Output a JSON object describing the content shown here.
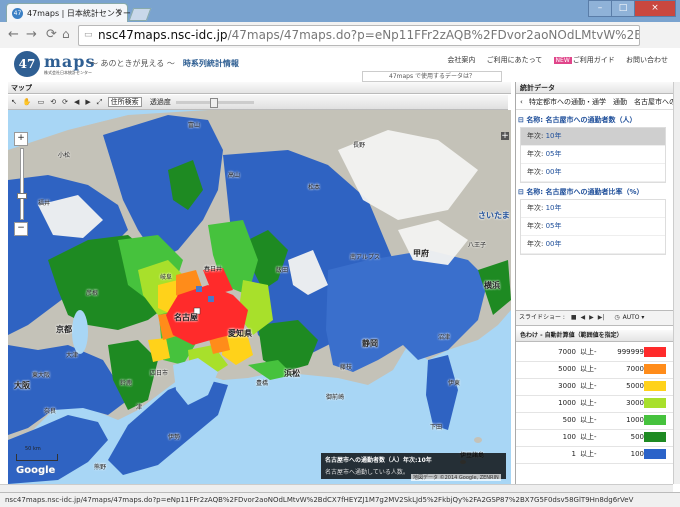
{
  "browser": {
    "tab_title": "47maps | 日本統計センター",
    "favicon_text": "47",
    "url_host": "nsc47maps.nsc-idc.jp",
    "url_path": "/47maps/47maps.do?p=eNp11FFr2zAQB%2FDvor2aoNOdLMtvW%2BdCX7fHEYZJ1M7g2M",
    "status_url": "nsc47maps.nsc-idc.jp/47maps/47maps.do?p=eNp11FFr2zAQB%2FDvor2aoNOdLMtvW%2BdCX7fHEYZJ1M7g2MV2SkLJd5%2FkbjQy%2FA2GSP87%2BX7G5F0dsv58GlT9Hn8dg6rVeV"
  },
  "site": {
    "logo_number": "47",
    "logo_name": "maps",
    "logo_company": "株式会社日本統計センター",
    "slogan_prefix": "～ あのときが見える ～",
    "slogan_title": "時系列統計情報",
    "links": [
      "会社案内",
      "ご利用にあたって",
      "ご利用ガイド",
      "お問い合わせ"
    ],
    "new_badge": "NEW",
    "notice": "47maps で使用するデータは？"
  },
  "map_panel": {
    "title": "マップ",
    "tools": [
      "↖",
      "✋",
      "▭",
      "⟲",
      "⟳",
      "◀",
      "▶",
      "⤢"
    ],
    "address_search": "住所検索",
    "opacity_label": "透過度",
    "opacity_value": 0.45,
    "legend_title": "名古屋市への通勤者数（人）年次:10年",
    "legend_desc": "名古屋市へ通勤している人数。",
    "copyright": "地図データ ©2014 Google, ZENRIN",
    "scale": "50 km",
    "google": "Google"
  },
  "map_labels": [
    {
      "t": "名古屋",
      "k": "b"
    },
    {
      "t": "愛知県",
      "k": "b"
    },
    {
      "t": "岐阜",
      "k": "b"
    },
    {
      "t": "静岡",
      "k": "b"
    },
    {
      "t": "浜松",
      "k": "b"
    },
    {
      "t": "京都",
      "k": "b"
    },
    {
      "t": "大阪",
      "k": "b"
    },
    {
      "t": "東大阪",
      "k": "s"
    },
    {
      "t": "甲府",
      "k": "b"
    },
    {
      "t": "さいたま",
      "k": "b"
    },
    {
      "t": "横浜",
      "k": "b"
    },
    {
      "t": "富山",
      "k": "s"
    },
    {
      "t": "高山",
      "k": "s"
    },
    {
      "t": "長野",
      "k": "s"
    },
    {
      "t": "松本",
      "k": "s"
    },
    {
      "t": "飯田",
      "k": "s"
    },
    {
      "t": "四日市",
      "k": "s"
    },
    {
      "t": "津",
      "k": "s"
    },
    {
      "t": "豊橋",
      "k": "s"
    },
    {
      "t": "伊勢",
      "k": "s"
    },
    {
      "t": "沼津",
      "k": "s"
    },
    {
      "t": "伊東",
      "k": "s"
    },
    {
      "t": "下田",
      "k": "s"
    },
    {
      "t": "南アルプス",
      "k": "s"
    },
    {
      "t": "御前崎",
      "k": "s"
    },
    {
      "t": "伊豆諸島",
      "k": "s"
    },
    {
      "t": "八王子",
      "k": "s"
    },
    {
      "t": "春日井",
      "k": "s"
    },
    {
      "t": "彦根",
      "k": "s"
    },
    {
      "t": "大津",
      "k": "s"
    },
    {
      "t": "鈴鹿",
      "k": "s"
    },
    {
      "t": "奈良",
      "k": "s"
    },
    {
      "t": "小松",
      "k": "s"
    },
    {
      "t": "福井",
      "k": "s"
    },
    {
      "t": "藤枝",
      "k": "s"
    },
    {
      "t": "熊野",
      "k": "s"
    }
  ],
  "stats_panel": {
    "title": "統計データ",
    "breadcrumb": "特定都市への通勤・通学　通勤　名古屋市への通勤者数",
    "section1_title": "名称: 名古屋市への通勤者数（人）",
    "section1_years": [
      {
        "key": "年次:",
        "val": "10年",
        "selected": true
      },
      {
        "key": "年次:",
        "val": "05年",
        "selected": false
      },
      {
        "key": "年次:",
        "val": "00年",
        "selected": false
      }
    ],
    "section2_title": "名称: 名古屋市への通勤者比率（%）",
    "section2_years": [
      {
        "key": "年次:",
        "val": "10年"
      },
      {
        "key": "年次:",
        "val": "05年"
      },
      {
        "key": "年次:",
        "val": "00年"
      }
    ],
    "slideshow_label": "スライドショー :",
    "auto_label": "AUTO",
    "legend_title": "色わけ - 自動計算値（範囲値を指定）",
    "legend_rows": [
      {
        "from": "7000",
        "unit": "以上-",
        "to": "999999",
        "color": "#ff2b2b"
      },
      {
        "from": "5000",
        "unit": "以上-",
        "to": "7000",
        "color": "#ff8c1a"
      },
      {
        "from": "3000",
        "unit": "以上-",
        "to": "5000",
        "color": "#ffd21a"
      },
      {
        "from": "1000",
        "unit": "以上-",
        "to": "3000",
        "color": "#a8e02b"
      },
      {
        "from": "500",
        "unit": "以上-",
        "to": "1000",
        "color": "#46c23d"
      },
      {
        "from": "100",
        "unit": "以上-",
        "to": "500",
        "color": "#1e8a22"
      },
      {
        "from": "1",
        "unit": "以上-",
        "to": "100",
        "color": "#2b63c9"
      }
    ]
  }
}
